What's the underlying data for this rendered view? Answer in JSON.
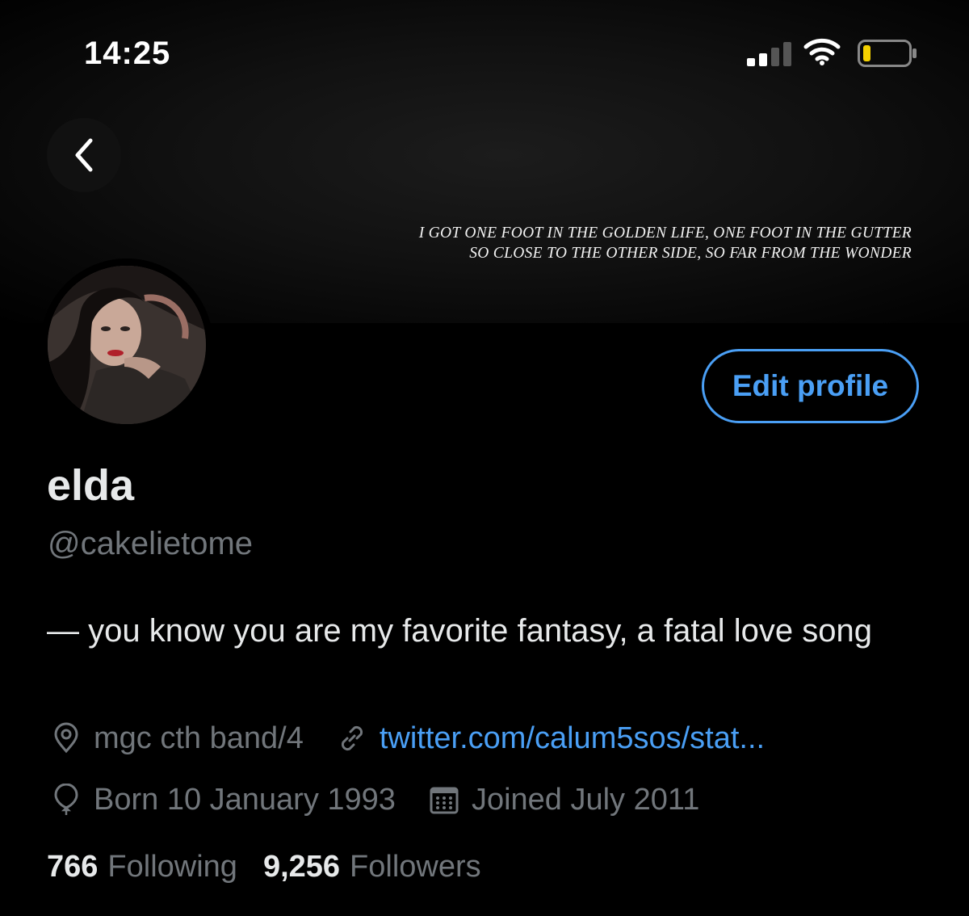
{
  "status_bar": {
    "time": "14:25"
  },
  "banner": {
    "quote_line1": "I GOT ONE FOOT IN THE GOLDEN LIFE, ONE FOOT IN THE GUTTER",
    "quote_line2": "SO CLOSE TO THE OTHER SIDE, SO FAR FROM THE WONDER"
  },
  "profile": {
    "edit_label": "Edit profile",
    "name": "elda",
    "handle": "@cakelietome",
    "bio": "— you know you are my favorite fantasy, a fatal love song",
    "location": "mgc cth band/4",
    "link": "twitter.com/calum5sos/stat...",
    "birthday": "Born 10 January 1993",
    "joined": "Joined July 2011",
    "following_count": "766",
    "following_label": "Following",
    "followers_count": "9,256",
    "followers_label": "Followers"
  },
  "colors": {
    "accent": "#4a9ff5",
    "secondary_text": "#71767b",
    "primary_text": "#e7e9ea"
  },
  "icons": [
    "back-chevron-icon",
    "location-pin-icon",
    "link-icon",
    "balloon-icon",
    "calendar-icon",
    "signal-icon",
    "wifi-icon",
    "battery-icon"
  ]
}
